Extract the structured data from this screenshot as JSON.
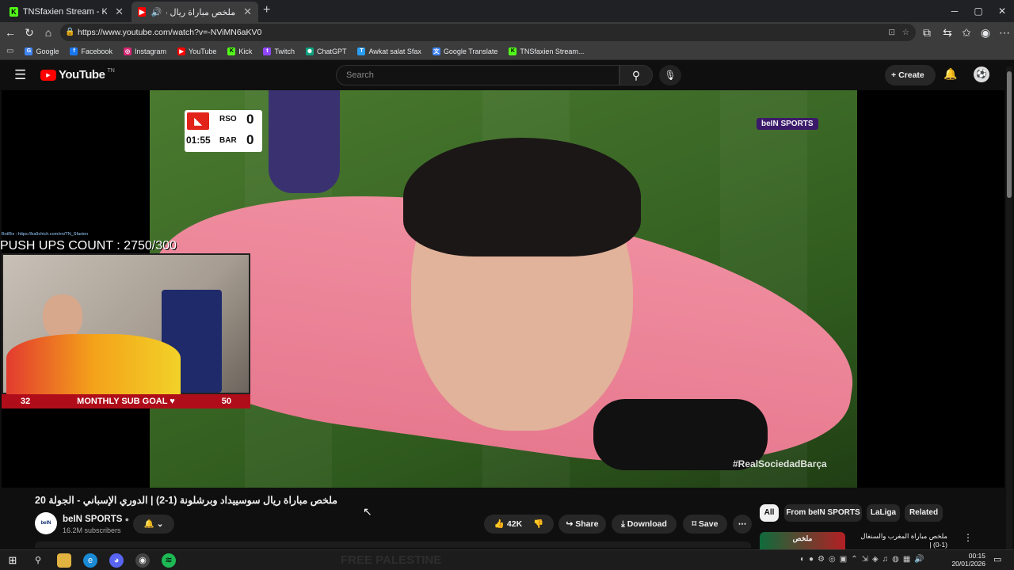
{
  "browser": {
    "tabs": [
      {
        "label": "TNSfaxien Stream - Kick Dashboar",
        "icon": "kick-icon",
        "active": false
      },
      {
        "label": "ملخص مباراة ريال سوسييداد و",
        "icon": "youtube-icon",
        "active": true
      }
    ],
    "new_tab": "+",
    "url": "https://www.youtube.com/watch?v=-NViMN6aKV0",
    "bookmarks": [
      {
        "label": "Google",
        "icon": "google-icon",
        "color": "#4285f4"
      },
      {
        "label": "Facebook",
        "icon": "facebook-icon",
        "color": "#1877f2"
      },
      {
        "label": "Instagram",
        "icon": "instagram-icon",
        "color": "#d62976"
      },
      {
        "label": "YouTube",
        "icon": "youtube-icon",
        "color": "#ff0000"
      },
      {
        "label": "Kick",
        "icon": "kick-icon",
        "color": "#53fc18"
      },
      {
        "label": "Twitch",
        "icon": "twitch-icon",
        "color": "#9146ff"
      },
      {
        "label": "ChatGPT",
        "icon": "chatgpt-icon",
        "color": "#10a37f"
      },
      {
        "label": "Awkat salat Sfax",
        "icon": "mosque-icon",
        "color": "#2a9df4"
      },
      {
        "label": "Google Translate",
        "icon": "translate-icon",
        "color": "#4285f4"
      },
      {
        "label": "TNSfaxien Stream...",
        "icon": "kick-icon",
        "color": "#53fc18"
      }
    ]
  },
  "youtube": {
    "logo": "YouTube",
    "logo_suffix": "TN",
    "search_placeholder": "Search",
    "create_label": "Create"
  },
  "overlay": {
    "scoreboard": {
      "team1": "RSO",
      "team2": "BAR",
      "score1": "0",
      "score2": "0",
      "time": "01:55"
    },
    "broadcaster": "beIN SPORTS",
    "hashtag": "#RealSociedadBarça",
    "bot_line": "BotRix : https://ba9chich.com/en/TN_Sfaxien",
    "pushups": "PUSH UPS COUNT : 2750/300",
    "subgoal": {
      "current": "32",
      "label": "MONTHLY SUB GOAL ♥",
      "target": "50"
    },
    "watermark": "FREE PALESTINE"
  },
  "video": {
    "title": "ملخص مباراة ريال سوسييداد وبرشلونة (1-2) | الدوري الإسباني - الجولة 20",
    "channel": "beIN SPORTS",
    "subscribers": "16.2M subscribers",
    "likes": "42K",
    "share_label": "Share",
    "download_label": "Download",
    "save_label": "Save"
  },
  "chips": [
    "All",
    "From beIN SPORTS",
    "LaLiga",
    "Related"
  ],
  "related": {
    "title": "ملخص مباراة المغرب والسنغال (1-0) |",
    "thumb_text": "ملخص"
  },
  "clock": {
    "time": "00:15",
    "date": "20/01/2026"
  },
  "accent": "#ff0000"
}
